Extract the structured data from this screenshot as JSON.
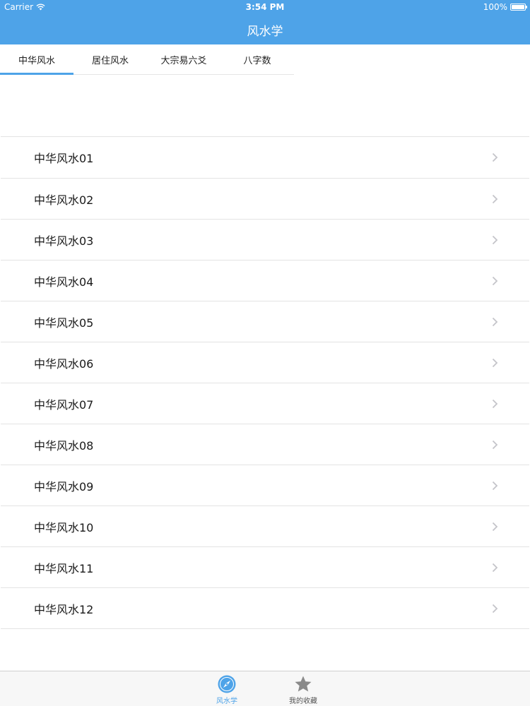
{
  "status_bar": {
    "carrier": "Carrier",
    "time": "3:54 PM",
    "battery": "100%",
    "battery_level": 1.0
  },
  "nav": {
    "title": "风水学"
  },
  "tabs": [
    {
      "label": "中华风水",
      "active": true
    },
    {
      "label": "居住风水",
      "active": false
    },
    {
      "label": "大宗易六爻",
      "active": false
    },
    {
      "label": "八字数",
      "active": false
    }
  ],
  "list": {
    "items": [
      "中华风水01",
      "中华风水02",
      "中华风水03",
      "中华风水04",
      "中华风水05",
      "中华风水06",
      "中华风水07",
      "中华风水08",
      "中华风水09",
      "中华风水10",
      "中华风水11",
      "中华风水12"
    ]
  },
  "tab_bar": {
    "items": [
      {
        "label": "风水学",
        "icon": "compass-icon",
        "active": true
      },
      {
        "label": "我的收藏",
        "icon": "star-icon",
        "active": false
      }
    ]
  },
  "colors": {
    "accent": "#4ea3e8",
    "inactive": "#555555"
  }
}
